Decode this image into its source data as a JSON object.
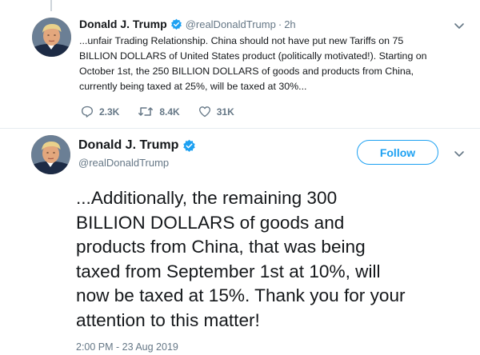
{
  "tweet1": {
    "author_name": "Donald J. Trump",
    "handle": "@realDonaldTrump",
    "separator": "·",
    "time": "2h",
    "text_lines": [
      "...unfair Trading Relationship. China should not have put new Tariffs on 75",
      "BILLION DOLLARS of United States product (politically motivated!). Starting on",
      "October 1st, the 250 BILLION DOLLARS of goods and products from China,",
      "currently being taxed at 25%, will be taxed at 30%..."
    ],
    "reply_count": "2.3K",
    "retweet_count": "8.4K",
    "like_count": "31K"
  },
  "tweet2": {
    "author_name": "Donald J. Trump",
    "handle": "@realDonaldTrump",
    "follow_label": "Follow",
    "text_lines": [
      "...Additionally, the remaining 300",
      "BILLION DOLLARS of goods and",
      "products from China, that was being",
      "taxed from September 1st at 10%, will",
      "now be taxed at 15%. Thank you for your",
      "attention to this matter!"
    ],
    "timestamp": "2:00 PM - 23 Aug 2019"
  },
  "colors": {
    "accent": "#1da1f2",
    "muted": "#657786",
    "text": "#14171a",
    "divider": "#e6ecf0"
  },
  "icons": {
    "verified": "verified-badge-icon",
    "reply": "reply-icon",
    "retweet": "retweet-icon",
    "like": "heart-icon",
    "more": "chevron-down-icon"
  }
}
